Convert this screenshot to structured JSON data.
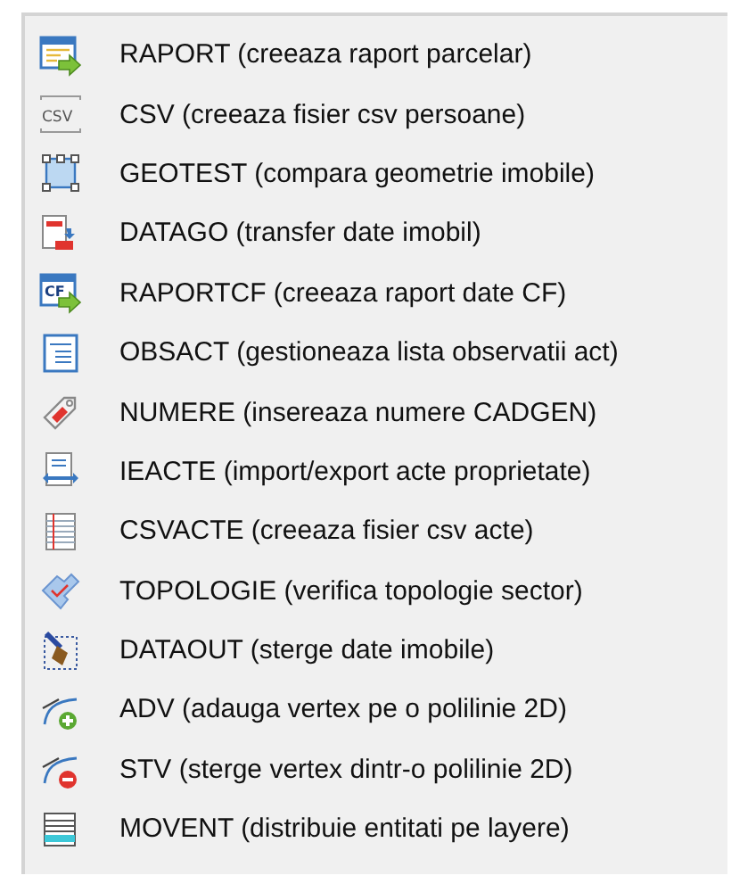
{
  "menu": {
    "items": [
      {
        "kind": "report",
        "label": "RAPORT (creeaza raport parcelar)"
      },
      {
        "kind": "csv",
        "icon_label": "CSV",
        "label": "CSV (creeaza fisier csv persoane)"
      },
      {
        "kind": "geometry",
        "label": "GEOTEST (compara geometrie imobile)"
      },
      {
        "kind": "transfer",
        "label": "DATAGO (transfer date imobil)"
      },
      {
        "kind": "report-cf",
        "icon_label": "CF",
        "label": "RAPORTCF (creeaza raport date CF)"
      },
      {
        "kind": "list",
        "label": "OBSACT (gestioneaza lista observatii act)"
      },
      {
        "kind": "tag",
        "label": "NUMERE (insereaza numere CADGEN)"
      },
      {
        "kind": "import-export",
        "label": "IEACTE (import/export acte proprietate)"
      },
      {
        "kind": "notebook",
        "label": "CSVACTE (creeaza fisier csv acte)"
      },
      {
        "kind": "topology",
        "label": "TOPOLOGIE (verifica topologie sector)"
      },
      {
        "kind": "brush",
        "label": "DATAOUT (sterge date imobile)"
      },
      {
        "kind": "vertex-add",
        "label": "ADV (adauga vertex pe o polilinie 2D)"
      },
      {
        "kind": "vertex-remove",
        "label": "STV (sterge vertex dintr-o polilinie 2D)"
      },
      {
        "kind": "layers",
        "label": "MOVENT (distribuie entitati pe layere)"
      }
    ]
  }
}
